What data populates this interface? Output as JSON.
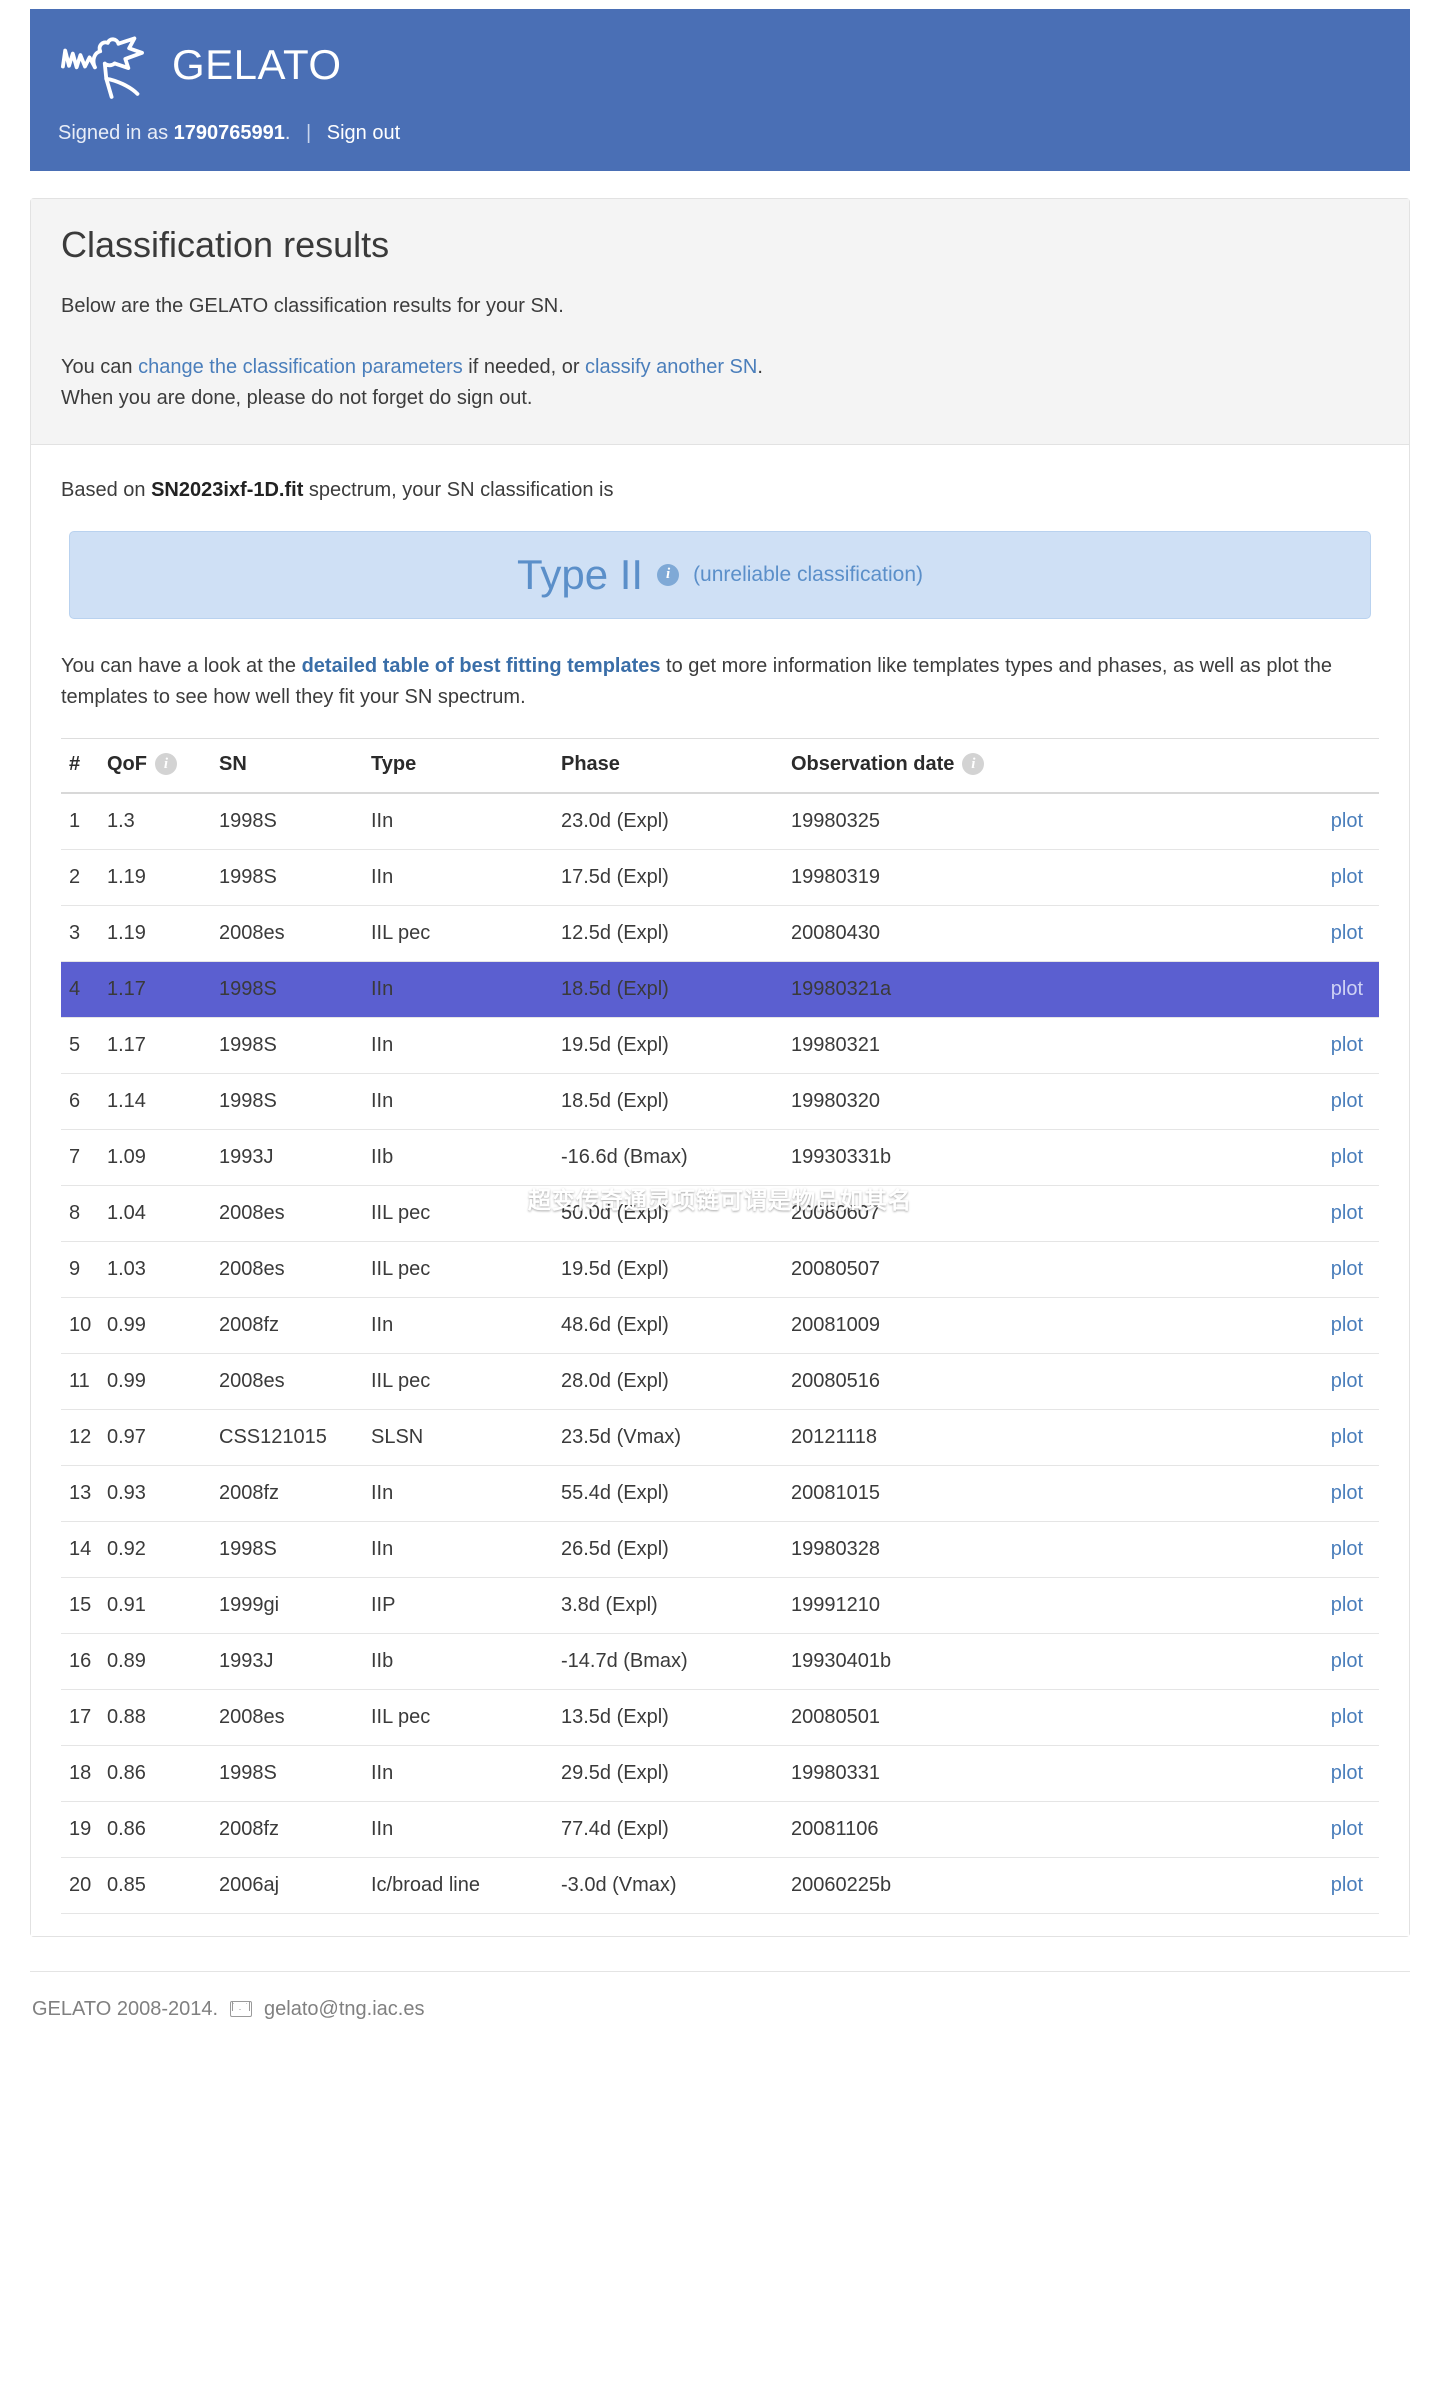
{
  "header": {
    "brand": "GELATO",
    "logo_icon": "gelato-squiggle-logo",
    "signed_in_prefix": "Signed in as",
    "username": "1790765991",
    "period": ".",
    "divider": "|",
    "sign_out": "Sign out"
  },
  "page": {
    "title": "Classification results",
    "intro": "Below are the GELATO classification results for your SN.",
    "para2_pre": "You can ",
    "para2_link1": "change the classification parameters",
    "para2_mid": " if needed, or ",
    "para2_link2": "classify another SN",
    "para2_post": ".",
    "para3": "When you are done, please do not forget do sign out.",
    "based_on_pre": "Based on ",
    "spectrum_file": "SN2023ixf-1D.fit",
    "based_on_post": " spectrum, your SN classification is"
  },
  "classification": {
    "type": "Type II",
    "info_icon": "info-icon",
    "note": "(unreliable classification)"
  },
  "table_intro": {
    "pre": "You can have a look at the ",
    "link": "detailed table of best fitting templates",
    "post": " to get more information like templates types and phases, as well as plot the templates to see how well they fit your SN spectrum."
  },
  "table": {
    "columns": [
      "#",
      "QoF",
      "SN",
      "Type",
      "Phase",
      "Observation date",
      ""
    ],
    "qof_info_icon": "info-icon",
    "date_info_icon": "info-icon",
    "plot_label": "plot",
    "highlight_row_index": 3,
    "rows": [
      {
        "num": "1",
        "qof": "1.3",
        "sn": "1998S",
        "type": "IIn",
        "phase": "23.0d (Expl)",
        "date": "19980325",
        "plot": "plot"
      },
      {
        "num": "2",
        "qof": "1.19",
        "sn": "1998S",
        "type": "IIn",
        "phase": "17.5d (Expl)",
        "date": "19980319",
        "plot": "plot"
      },
      {
        "num": "3",
        "qof": "1.19",
        "sn": "2008es",
        "type": "IIL pec",
        "phase": "12.5d (Expl)",
        "date": "20080430",
        "plot": "plot"
      },
      {
        "num": "4",
        "qof": "1.17",
        "sn": "1998S",
        "type": "IIn",
        "phase": "18.5d (Expl)",
        "date": "19980321a",
        "plot": "plot"
      },
      {
        "num": "5",
        "qof": "1.17",
        "sn": "1998S",
        "type": "IIn",
        "phase": "19.5d (Expl)",
        "date": "19980321",
        "plot": "plot"
      },
      {
        "num": "6",
        "qof": "1.14",
        "sn": "1998S",
        "type": "IIn",
        "phase": "18.5d (Expl)",
        "date": "19980320",
        "plot": "plot"
      },
      {
        "num": "7",
        "qof": "1.09",
        "sn": "1993J",
        "type": "IIb",
        "phase": "-16.6d (Bmax)",
        "date": "19930331b",
        "plot": "plot"
      },
      {
        "num": "8",
        "qof": "1.04",
        "sn": "2008es",
        "type": "IIL pec",
        "phase": "50.0d (Expl)",
        "date": "20080607",
        "plot": "plot"
      },
      {
        "num": "9",
        "qof": "1.03",
        "sn": "2008es",
        "type": "IIL pec",
        "phase": "19.5d (Expl)",
        "date": "20080507",
        "plot": "plot"
      },
      {
        "num": "10",
        "qof": "0.99",
        "sn": "2008fz",
        "type": "IIn",
        "phase": "48.6d (Expl)",
        "date": "20081009",
        "plot": "plot"
      },
      {
        "num": "11",
        "qof": "0.99",
        "sn": "2008es",
        "type": "IIL pec",
        "phase": "28.0d (Expl)",
        "date": "20080516",
        "plot": "plot"
      },
      {
        "num": "12",
        "qof": "0.97",
        "sn": "CSS121015",
        "type": "SLSN",
        "phase": "23.5d (Vmax)",
        "date": "20121118",
        "plot": "plot"
      },
      {
        "num": "13",
        "qof": "0.93",
        "sn": "2008fz",
        "type": "IIn",
        "phase": "55.4d (Expl)",
        "date": "20081015",
        "plot": "plot"
      },
      {
        "num": "14",
        "qof": "0.92",
        "sn": "1998S",
        "type": "IIn",
        "phase": "26.5d (Expl)",
        "date": "19980328",
        "plot": "plot"
      },
      {
        "num": "15",
        "qof": "0.91",
        "sn": "1999gi",
        "type": "IIP",
        "phase": "3.8d (Expl)",
        "date": "19991210",
        "plot": "plot"
      },
      {
        "num": "16",
        "qof": "0.89",
        "sn": "1993J",
        "type": "IIb",
        "phase": "-14.7d (Bmax)",
        "date": "19930401b",
        "plot": "plot"
      },
      {
        "num": "17",
        "qof": "0.88",
        "sn": "2008es",
        "type": "IIL pec",
        "phase": "13.5d (Expl)",
        "date": "20080501",
        "plot": "plot"
      },
      {
        "num": "18",
        "qof": "0.86",
        "sn": "1998S",
        "type": "IIn",
        "phase": "29.5d (Expl)",
        "date": "19980331",
        "plot": "plot"
      },
      {
        "num": "19",
        "qof": "0.86",
        "sn": "2008fz",
        "type": "IIn",
        "phase": "77.4d (Expl)",
        "date": "20081106",
        "plot": "plot"
      },
      {
        "num": "20",
        "qof": "0.85",
        "sn": "2006aj",
        "type": "Ic/broad line",
        "phase": "-3.0d (Vmax)",
        "date": "20060225b",
        "plot": "plot"
      }
    ]
  },
  "overlay": {
    "text": "超变传奇通灵项链可谓是物品如其名"
  },
  "footer": {
    "copyright": "GELATO 2008-2014.",
    "mail_icon": "envelope-icon",
    "email": "gelato@tng.iac.es"
  },
  "colors": {
    "header_blue": "#4a6fb5",
    "link_blue": "#4a7ebb",
    "type_box_bg": "#cfe0f5",
    "highlight_row": "#5b5fd0"
  }
}
